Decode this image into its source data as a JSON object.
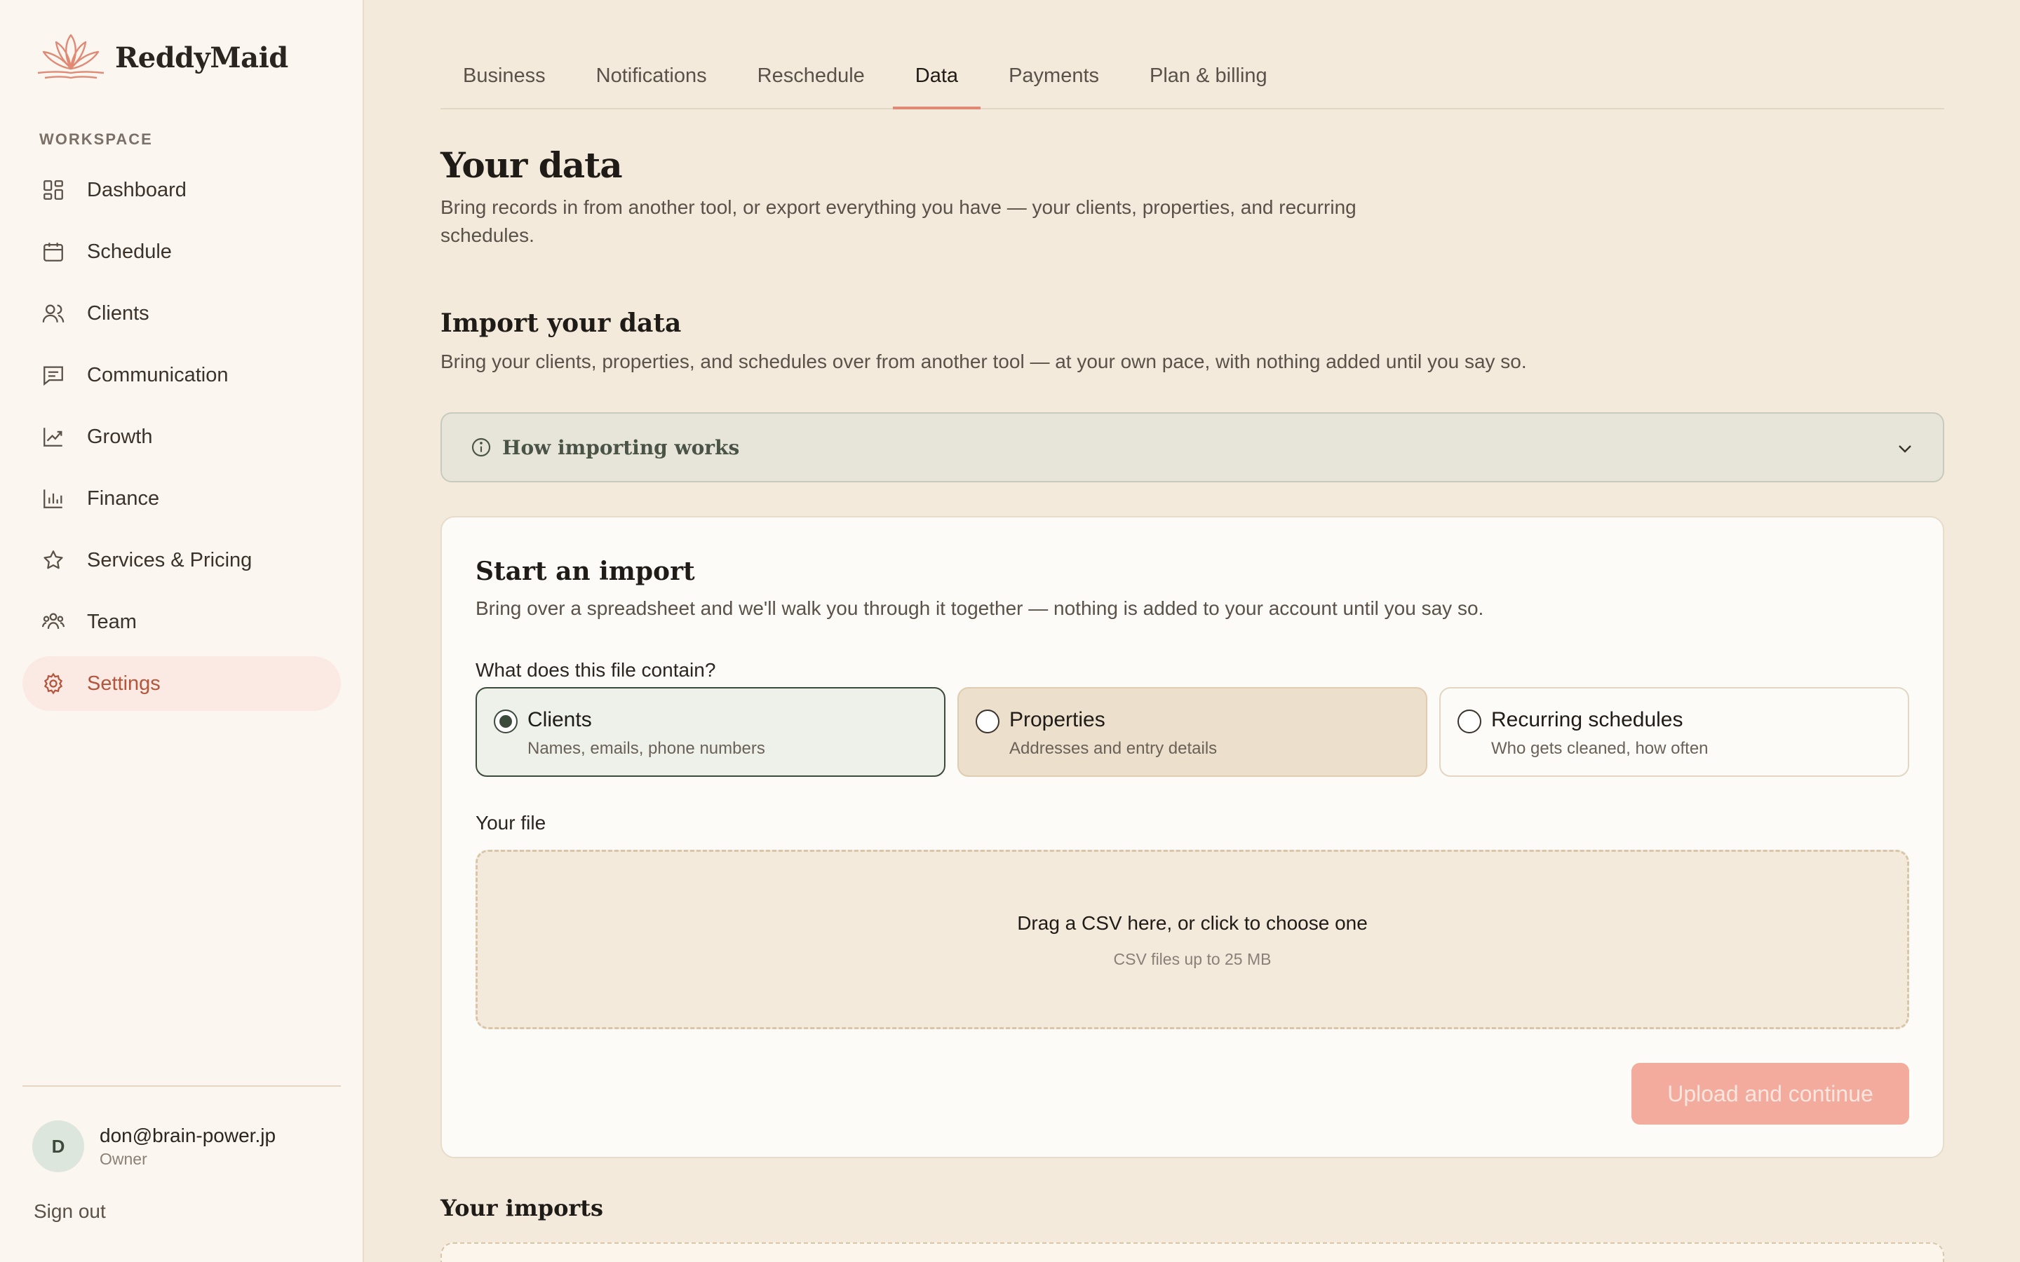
{
  "brand": {
    "name": "ReddyMaid",
    "logo_icon": "lotus-icon",
    "accent": "#e08a76"
  },
  "sidebar": {
    "section_label": "WORKSPACE",
    "items": [
      {
        "label": "Dashboard",
        "icon": "grid-icon"
      },
      {
        "label": "Schedule",
        "icon": "calendar-icon"
      },
      {
        "label": "Clients",
        "icon": "users-icon"
      },
      {
        "label": "Communication",
        "icon": "message-icon"
      },
      {
        "label": "Growth",
        "icon": "trend-icon"
      },
      {
        "label": "Finance",
        "icon": "bar-chart-icon"
      },
      {
        "label": "Services & Pricing",
        "icon": "star-icon"
      },
      {
        "label": "Team",
        "icon": "team-icon"
      },
      {
        "label": "Settings",
        "icon": "gear-icon",
        "active": true
      }
    ],
    "user": {
      "initial": "D",
      "email": "don@brain-power.jp",
      "role": "Owner"
    },
    "sign_out": "Sign out"
  },
  "tabs": [
    {
      "label": "Business"
    },
    {
      "label": "Notifications"
    },
    {
      "label": "Reschedule"
    },
    {
      "label": "Data",
      "active": true
    },
    {
      "label": "Payments"
    },
    {
      "label": "Plan & billing"
    }
  ],
  "page": {
    "title": "Your data",
    "lead": "Bring records in from another tool, or export everything you have — your clients, properties, and recurring schedules."
  },
  "import": {
    "title": "Import your data",
    "subtitle": "Bring your clients, properties, and schedules over from another tool — at your own pace, with nothing added until you say so.",
    "accordion_title": "How importing works"
  },
  "start_import": {
    "title": "Start an import",
    "subtitle": "Bring over a spreadsheet and we'll walk you through it together — nothing is added to your account until you say so.",
    "question": "What does this file contain?",
    "options": [
      {
        "title": "Clients",
        "desc": "Names, emails, phone numbers",
        "selected": true
      },
      {
        "title": "Properties",
        "desc": "Addresses and entry details"
      },
      {
        "title": "Recurring schedules",
        "desc": "Who gets cleaned, how often"
      }
    ],
    "file_label": "Your file",
    "dropzone_main": "Drag a CSV here, or click to choose one",
    "dropzone_sub": "CSV files up to 25 MB",
    "upload_button": "Upload and continue"
  },
  "your_imports": {
    "title": "Your imports"
  }
}
